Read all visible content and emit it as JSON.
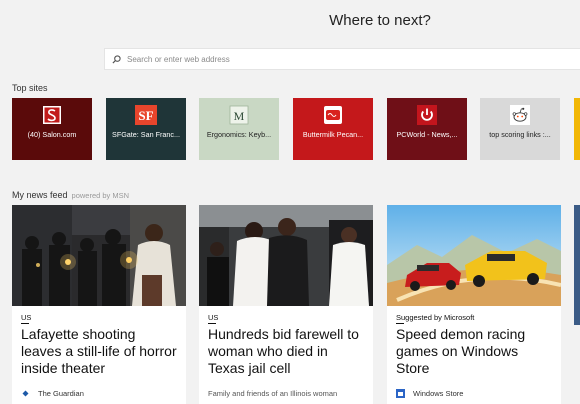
{
  "heading": "Where to next?",
  "search": {
    "placeholder": "Search or enter web address"
  },
  "top_sites": {
    "label": "Top sites",
    "tiles": [
      {
        "label": "(40) Salon.com",
        "bg": "#5a0a0a",
        "fg": "#ffffff",
        "icon": "salon-icon"
      },
      {
        "label": "SFGate: San Franc...",
        "bg": "#1f3538",
        "fg": "#ffffff",
        "icon": "sfgate-icon"
      },
      {
        "label": "Ergonomics: Keyb...",
        "bg": "#c9d8c4",
        "fg": "#222222",
        "icon": "ergonomics-icon"
      },
      {
        "label": "Buttermilk Pecan...",
        "bg": "#c4181b",
        "fg": "#ffffff",
        "icon": "buttermilk-icon"
      },
      {
        "label": "PCWorld - News,...",
        "bg": "#6f0f17",
        "fg": "#ffffff",
        "icon": "power-icon"
      },
      {
        "label": "top scoring links :...",
        "bg": "#d9d9d9",
        "fg": "#222222",
        "icon": "reddit-icon"
      }
    ]
  },
  "news": {
    "label": "My news feed",
    "powered_by": "powered by MSN",
    "cards": [
      {
        "kicker": "US",
        "title": "Lafayette shooting leaves a still-life of horror inside theater",
        "source": "The Guardian",
        "snippet": ""
      },
      {
        "kicker": "US",
        "title": "Hundreds bid farewell to woman who died in Texas jail cell",
        "source": "",
        "snippet": "Family and friends of an Illinois woman"
      },
      {
        "kicker": "Suggested by Microsoft",
        "title": "Speed demon racing games on Windows Store",
        "source": "Windows Store",
        "snippet": ""
      }
    ]
  },
  "colors": {
    "page_bg": "#f2f2f2",
    "accent_yellow": "#f2b705",
    "link_blue": "#2b65c6"
  }
}
